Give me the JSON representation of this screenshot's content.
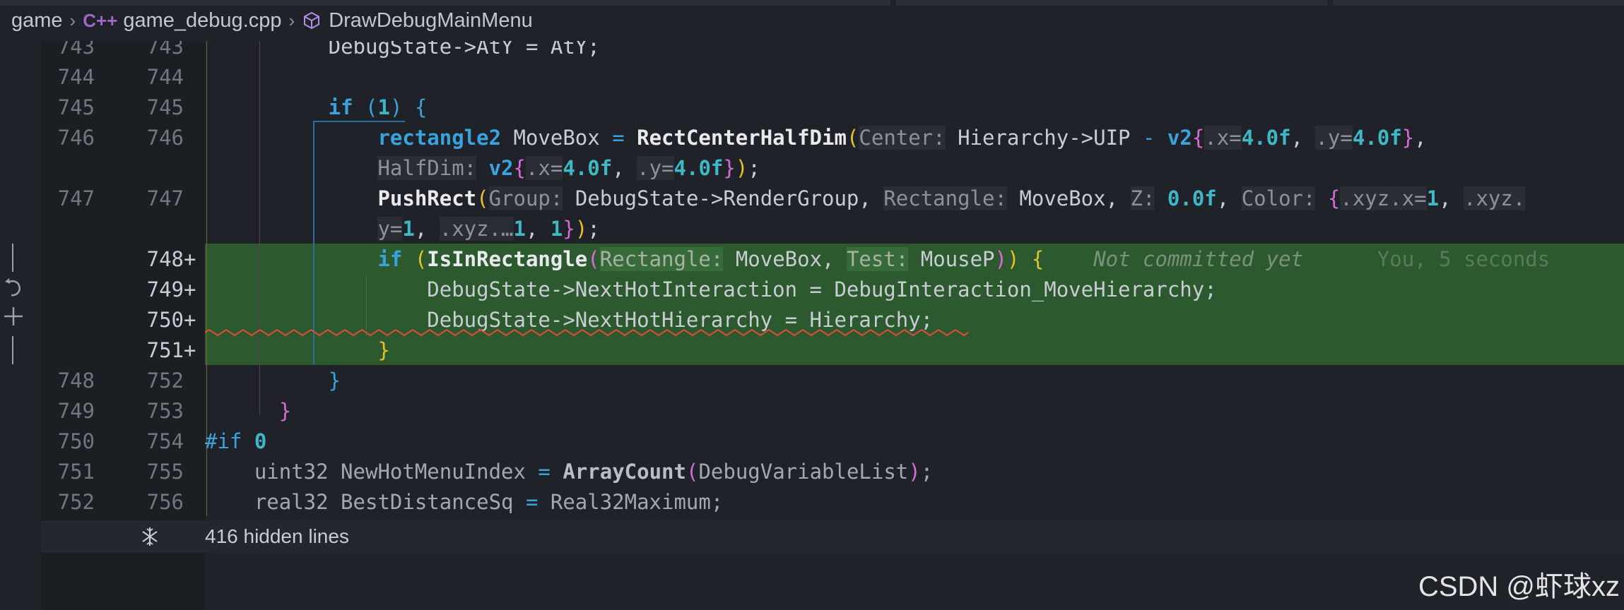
{
  "breadcrumb": {
    "folder": "game",
    "file_icon": "C++",
    "file": "game_debug.cpp",
    "symbol": "DrawDebugMainMenu"
  },
  "lines": [
    {
      "old": "743",
      "new": "743",
      "added": false
    },
    {
      "old": "744",
      "new": "744",
      "added": false
    },
    {
      "old": "745",
      "new": "745",
      "added": false
    },
    {
      "old": "746",
      "new": "746",
      "added": false
    },
    {
      "old": "",
      "new": "",
      "added": false
    },
    {
      "old": "747",
      "new": "747",
      "added": false
    },
    {
      "old": "",
      "new": "",
      "added": false
    },
    {
      "old": "",
      "new": "748",
      "added": true
    },
    {
      "old": "",
      "new": "749",
      "added": true
    },
    {
      "old": "",
      "new": "750",
      "added": true
    },
    {
      "old": "",
      "new": "751",
      "added": true
    },
    {
      "old": "748",
      "new": "752",
      "added": false
    },
    {
      "old": "749",
      "new": "753",
      "added": false
    },
    {
      "old": "750",
      "new": "754",
      "added": false
    },
    {
      "old": "751",
      "new": "755",
      "added": false
    },
    {
      "old": "752",
      "new": "756",
      "added": false
    }
  ],
  "code": {
    "l743": "DebugState->AtY = AtY;",
    "l745_kw": "if",
    "l745_num": "1",
    "l746_type": "rectangle2",
    "l746_a": " MoveBox ",
    "l746_eq": "=",
    "l746_fn": "RectCenterHalfDim",
    "l746_hint1": "Center:",
    "l746_b": " Hierarchy->UIP ",
    "l746_minus": "-",
    "l746_v2": "v2",
    "l746_hx": ".x=",
    "l746_n1": "4.0f",
    "l746_hy": ".y=",
    "l746_n2": "4.0f",
    "l746w_hint": "HalfDim:",
    "l746w_v2": "v2",
    "l746w_hx": ".x=",
    "l746w_n1": "4.0f",
    "l746w_hy": ".y=",
    "l746w_n2": "4.0f",
    "l747_fn": "PushRect",
    "l747_hint1": "Group:",
    "l747_a": " DebugState->RenderGroup, ",
    "l747_hint2": "Rectangle:",
    "l747_b": " MoveBox, ",
    "l747_hint3": "Z:",
    "l747_n1": "0.0f",
    "l747_hint4": "Color:",
    "l747_hx": ".xyz.x=",
    "l747_n2": "1",
    "l747_hxyz": ".xyz.",
    "l747w_hy": "y=",
    "l747w_n1": "1",
    "l747w_hz": ".xyz.…",
    "l747w_n2": "1",
    "l747w_n3": "1",
    "l748_kw": "if",
    "l748_fn": "IsInRectangle",
    "l748_hint1": "Rectangle:",
    "l748_a": " MoveBox, ",
    "l748_hint2": "Test:",
    "l748_b": " MouseP",
    "l748_blame": "Not committed yet",
    "l748_blame2": "You, 5 seconds",
    "l749": "DebugState->NextHotInteraction = DebugInteraction_MoveHierarchy;",
    "l750": "DebugState->NextHotHierarchy = Hierarchy;",
    "l754_prep": "#if",
    "l754_num": "0",
    "l755_a": "uint32 NewHotMenuIndex ",
    "l755_eq": "=",
    "l755_fn": "ArrayCount",
    "l755_b": "DebugVariableList",
    "l756_a": "real32 BestDistanceSq ",
    "l756_eq": "=",
    "l756_b": " Real32Maximum;"
  },
  "folded": {
    "text": "416 hidden lines"
  },
  "watermark": "CSDN @虾球xz",
  "colors": {
    "background": "#1f2228",
    "added_line": "#2c5a2e",
    "keyword": "#3aa3dd",
    "number": "#3fb7c5"
  }
}
